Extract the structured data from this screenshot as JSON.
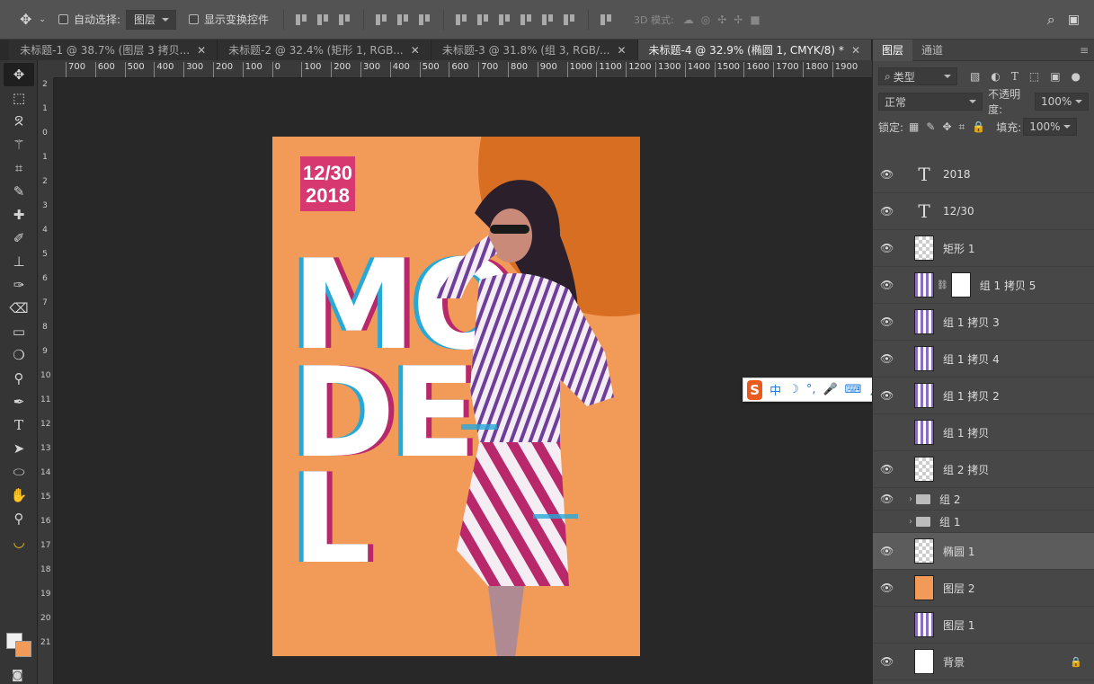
{
  "options_bar": {
    "auto_select_label": "自动选择:",
    "auto_select_value": "图层",
    "show_transform_label": "显示变换控件",
    "mode_3d_label": "3D 模式:"
  },
  "tabs": [
    {
      "label": "未标题-1 @ 38.7% (图层 3 拷贝..."
    },
    {
      "label": "未标题-2 @ 32.4% (矩形 1, RGB..."
    },
    {
      "label": "未标题-3 @ 31.8% (组 3, RGB/..."
    },
    {
      "label": "未标题-4 @ 32.9% (椭圆 1, CMYK/8) *"
    }
  ],
  "ruler": {
    "labels": [
      "700",
      "600",
      "500",
      "400",
      "300",
      "200",
      "100",
      "0",
      "100",
      "200",
      "300",
      "400",
      "500",
      "600",
      "700",
      "800",
      "900",
      "1000",
      "1100",
      "1200",
      "1300",
      "1400",
      "1500",
      "1600",
      "1700",
      "1800",
      "1900"
    ],
    "v_labels": [
      "2",
      "1",
      "0",
      "1",
      "2",
      "3",
      "4",
      "5",
      "6",
      "7",
      "8",
      "9",
      "10",
      "11",
      "12",
      "13",
      "14",
      "15",
      "16",
      "17",
      "18",
      "19",
      "20",
      "21"
    ]
  },
  "poster": {
    "date_line1": "12/30",
    "date_line2": "2018",
    "word_m": "MO",
    "word_d": "DE",
    "word_l": "L"
  },
  "panel": {
    "tab_layers": "图层",
    "tab_channels": "通道",
    "filter_label": "类型",
    "blend_mode": "正常",
    "opacity_label": "不透明度:",
    "opacity_value": "100%",
    "lock_label": "锁定:",
    "fill_label": "填充:",
    "fill_value": "100%"
  },
  "layers": [
    {
      "name": "2018",
      "kind": "text",
      "visible": true
    },
    {
      "name": "12/30",
      "kind": "text",
      "visible": true
    },
    {
      "name": "矩形 1",
      "kind": "rect",
      "visible": true
    },
    {
      "name": "组 1 拷贝 5",
      "kind": "masked",
      "visible": true
    },
    {
      "name": "组 1 拷贝 3",
      "kind": "person",
      "visible": true
    },
    {
      "name": "组 1 拷贝 4",
      "kind": "person",
      "visible": true
    },
    {
      "name": "组 1 拷贝 2",
      "kind": "person",
      "visible": true
    },
    {
      "name": "组 1 拷贝",
      "kind": "person",
      "visible": false
    },
    {
      "name": "组 2 拷贝",
      "kind": "rect",
      "visible": true
    },
    {
      "name": "组 2",
      "kind": "folder",
      "visible": true
    },
    {
      "name": "组 1",
      "kind": "folder",
      "visible": false
    },
    {
      "name": "椭圆 1",
      "kind": "rect",
      "visible": true,
      "selected": true
    },
    {
      "name": "图层 2",
      "kind": "orange",
      "visible": true
    },
    {
      "name": "图层 1",
      "kind": "person",
      "visible": false
    },
    {
      "name": "背景",
      "kind": "white",
      "visible": true,
      "locked": true
    }
  ],
  "ime_bar": {
    "logo": "S",
    "items": [
      "中",
      "☽",
      "°,",
      "🎤",
      "⌨",
      "👤",
      "👕",
      "🔧"
    ]
  },
  "colors": {
    "canvas_bg": "#282828",
    "poster_orange": "#f29a58",
    "date_box": "#d6386f",
    "accent_cyan": "#27a9d8"
  }
}
